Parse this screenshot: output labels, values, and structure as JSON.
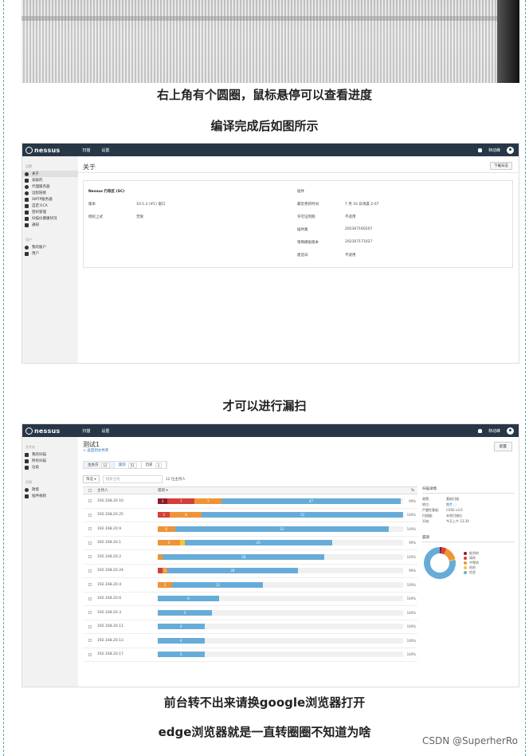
{
  "captions": {
    "c1": "右上角有个圆圈，鼠标悬停可以查看进度",
    "c2": "编译完成后如图所示",
    "c3": "才可以进行漏扫",
    "c4": "前台转不出来请换google浏览器打开",
    "c5": "edge浏览器就是一直转圈圈不知道为啥"
  },
  "watermark": "CSDN @SuperherRo",
  "app": {
    "logo": "nessus",
    "nav": [
      "扫描",
      "设置"
    ],
    "user": "林动峰"
  },
  "about": {
    "sidebar_sections": [
      "设置",
      "用户"
    ],
    "sidebar_items": [
      "关于",
      "高级的",
      "代理服务器",
      "远程链接",
      "SMTP服务器",
      "自定义CA",
      "密码管理",
      "扫描仪健康状况",
      "通知"
    ],
    "account_items": [
      "我的账户",
      "用户"
    ],
    "page_title": "关于",
    "download_button": "下载日志",
    "left": [
      {
        "k": "Nessus 行政区 (SC)",
        "v": ""
      },
      {
        "k": "版本",
        "v": "10.5.3 (#1) 窗口"
      },
      {
        "k": "授权上式",
        "v": "无限"
      }
    ],
    "right": [
      {
        "k": "插件",
        "v": ""
      },
      {
        "k": "最近更新时间",
        "v": "7 月 16 日清晨 2:07"
      },
      {
        "k": "许可证到期",
        "v": "不适用"
      },
      {
        "k": "插件集",
        "v": "202307160207"
      },
      {
        "k": "策略模板版本",
        "v": "202307171027"
      },
      {
        "k": "建造日",
        "v": "不适用"
      }
    ]
  },
  "scan": {
    "sidebar_sections": [
      "文件夹",
      "资源"
    ],
    "sidebar_items": [
      "我的扫描",
      "所有扫描",
      "垃圾"
    ],
    "resource_items": [
      "政策",
      "插件规则"
    ],
    "title": "测试1",
    "back_link": "< 返回到文件夹",
    "config_button": "配置",
    "tabs": [
      {
        "label": "主办方",
        "count": "12"
      },
      {
        "label": "漏洞",
        "count": "51"
      },
      {
        "label": "历史",
        "count": "1"
      }
    ],
    "filter_label": "筛选 ▾",
    "search_placeholder": "搜索主机",
    "host_count": "12 位主持人",
    "col_host": "主持人",
    "col_vuln": "漏洞 ▾",
    "col_pct": "%",
    "rows": [
      {
        "host": "192.168.20.10",
        "segs": [
          {
            "c": "#8b1a2b",
            "v": 3,
            "w": 4
          },
          {
            "c": "#d43f3a",
            "v": 7,
            "w": 11
          },
          {
            "c": "#ee9336",
            "v": 7,
            "w": 11
          },
          {
            "c": "#67acd8",
            "v": 47,
            "w": 73
          }
        ],
        "pct": "99%"
      },
      {
        "host": "192.168.20.25",
        "segs": [
          {
            "c": "#d43f3a",
            "v": 3,
            "w": 5
          },
          {
            "c": "#ee9336",
            "v": 8,
            "w": 13
          },
          {
            "c": "#67acd8",
            "v": 52,
            "w": 82
          }
        ],
        "pct": "100%"
      },
      {
        "host": "192.168.20.9",
        "segs": [
          {
            "c": "#ee9336",
            "v": 6,
            "w": 7
          },
          {
            "c": "#67acd8",
            "v": 33,
            "w": 87
          }
        ],
        "pct": "100%"
      },
      {
        "host": "192.168.20.1",
        "segs": [
          {
            "c": "#ee9336",
            "v": 5,
            "w": 9
          },
          {
            "c": "#fdc431",
            "v": "",
            "w": 2
          },
          {
            "c": "#67acd8",
            "v": 25,
            "w": 60
          }
        ],
        "pct": "99%"
      },
      {
        "host": "192.168.20.2",
        "segs": [
          {
            "c": "#ee9336",
            "v": "",
            "w": 2
          },
          {
            "c": "#67acd8",
            "v": 28,
            "w": 66
          }
        ],
        "pct": "100%"
      },
      {
        "host": "192.168.20.24",
        "segs": [
          {
            "c": "#d43f3a",
            "v": "",
            "w": 2
          },
          {
            "c": "#ee9336",
            "v": 3,
            "w": 2
          },
          {
            "c": "#67acd8",
            "v": 26,
            "w": 53
          }
        ],
        "pct": "99%"
      },
      {
        "host": "192.168.20.4",
        "segs": [
          {
            "c": "#ee9336",
            "v": 2,
            "w": 6
          },
          {
            "c": "#67acd8",
            "v": 13,
            "w": 37
          }
        ],
        "pct": "100%"
      },
      {
        "host": "192.168.20.6",
        "segs": [
          {
            "c": "#67acd8",
            "v": 6,
            "w": 25
          }
        ],
        "pct": "100%"
      },
      {
        "host": "192.168.20.3",
        "segs": [
          {
            "c": "#67acd8",
            "v": 5,
            "w": 22
          }
        ],
        "pct": "100%"
      },
      {
        "host": "192.168.20.11",
        "segs": [
          {
            "c": "#67acd8",
            "v": 4,
            "w": 19
          }
        ],
        "pct": "100%"
      },
      {
        "host": "192.168.20.13",
        "segs": [
          {
            "c": "#67acd8",
            "v": 4,
            "w": 19
          }
        ],
        "pct": "100%"
      },
      {
        "host": "192.168.20.17",
        "segs": [
          {
            "c": "#67acd8",
            "v": 4,
            "w": 19
          }
        ],
        "pct": "100%"
      }
    ],
    "details": {
      "header": "扫描详情",
      "rows": [
        {
          "k": "政策:",
          "v": "基础扫描"
        },
        {
          "k": "地位:",
          "v": "跑步 ◌"
        },
        {
          "k": "严重性基础:",
          "v": "CVSS v3.0"
        },
        {
          "k": "扫描器:",
          "v": "本地扫描仪"
        },
        {
          "k": "开始:",
          "v": "今天上午 12:34"
        }
      ],
      "vuln_header": "漏洞",
      "legend": [
        {
          "label": "批判的",
          "color": "#8b1a2b"
        },
        {
          "label": "高的",
          "color": "#d43f3a"
        },
        {
          "label": "中等的",
          "color": "#ee9336"
        },
        {
          "label": "低的",
          "color": "#fdc431"
        },
        {
          "label": "信息",
          "color": "#67acd8"
        }
      ]
    }
  }
}
